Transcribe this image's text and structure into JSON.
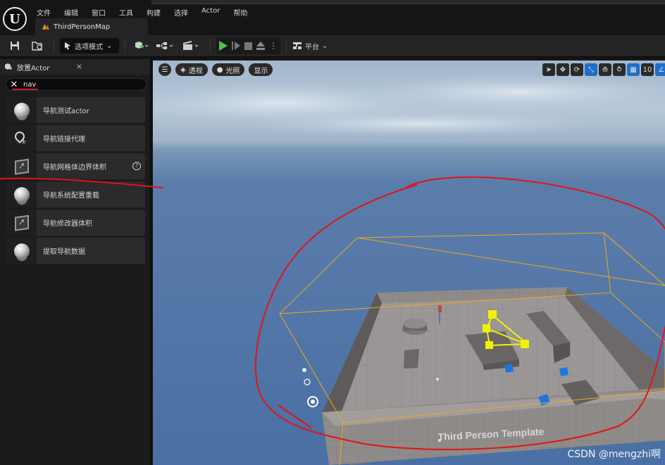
{
  "menubar": {
    "items": [
      "文件",
      "编辑",
      "窗口",
      "工具",
      "构建",
      "选择",
      "Actor",
      "帮助"
    ],
    "tab_label": "ThirdPersonMap"
  },
  "toolbar": {
    "mode_label": "选项模式",
    "platform_label": "平台"
  },
  "place_actor": {
    "title": "放置Actor",
    "close": "×",
    "search_value": "nav",
    "items": [
      {
        "label": "导航测试actor",
        "icon": "sphere-icon"
      },
      {
        "label": "导航链接代理",
        "icon": "nav-link-icon"
      },
      {
        "label": "导航网格体边界体积",
        "icon": "volume-cube-icon",
        "help": "?"
      },
      {
        "label": "导航系统配置重载",
        "icon": "sphere-icon"
      },
      {
        "label": "导航修改器体积",
        "icon": "volume-cube-icon"
      },
      {
        "label": "提取导航数据",
        "icon": "sphere-icon"
      }
    ]
  },
  "viewport": {
    "perspective_label": "透视",
    "lighting_label": "光照",
    "show_label": "显示",
    "grid_snap_value": "10",
    "floor_text": "Third Person Template"
  },
  "watermark": "CSDN @mengzhi啊",
  "colors": {
    "annotation_red": "#e01515",
    "nav_bounds": "#f0a818",
    "selected_yellow": "#f2f200",
    "blue_cube": "#1e74e0"
  }
}
